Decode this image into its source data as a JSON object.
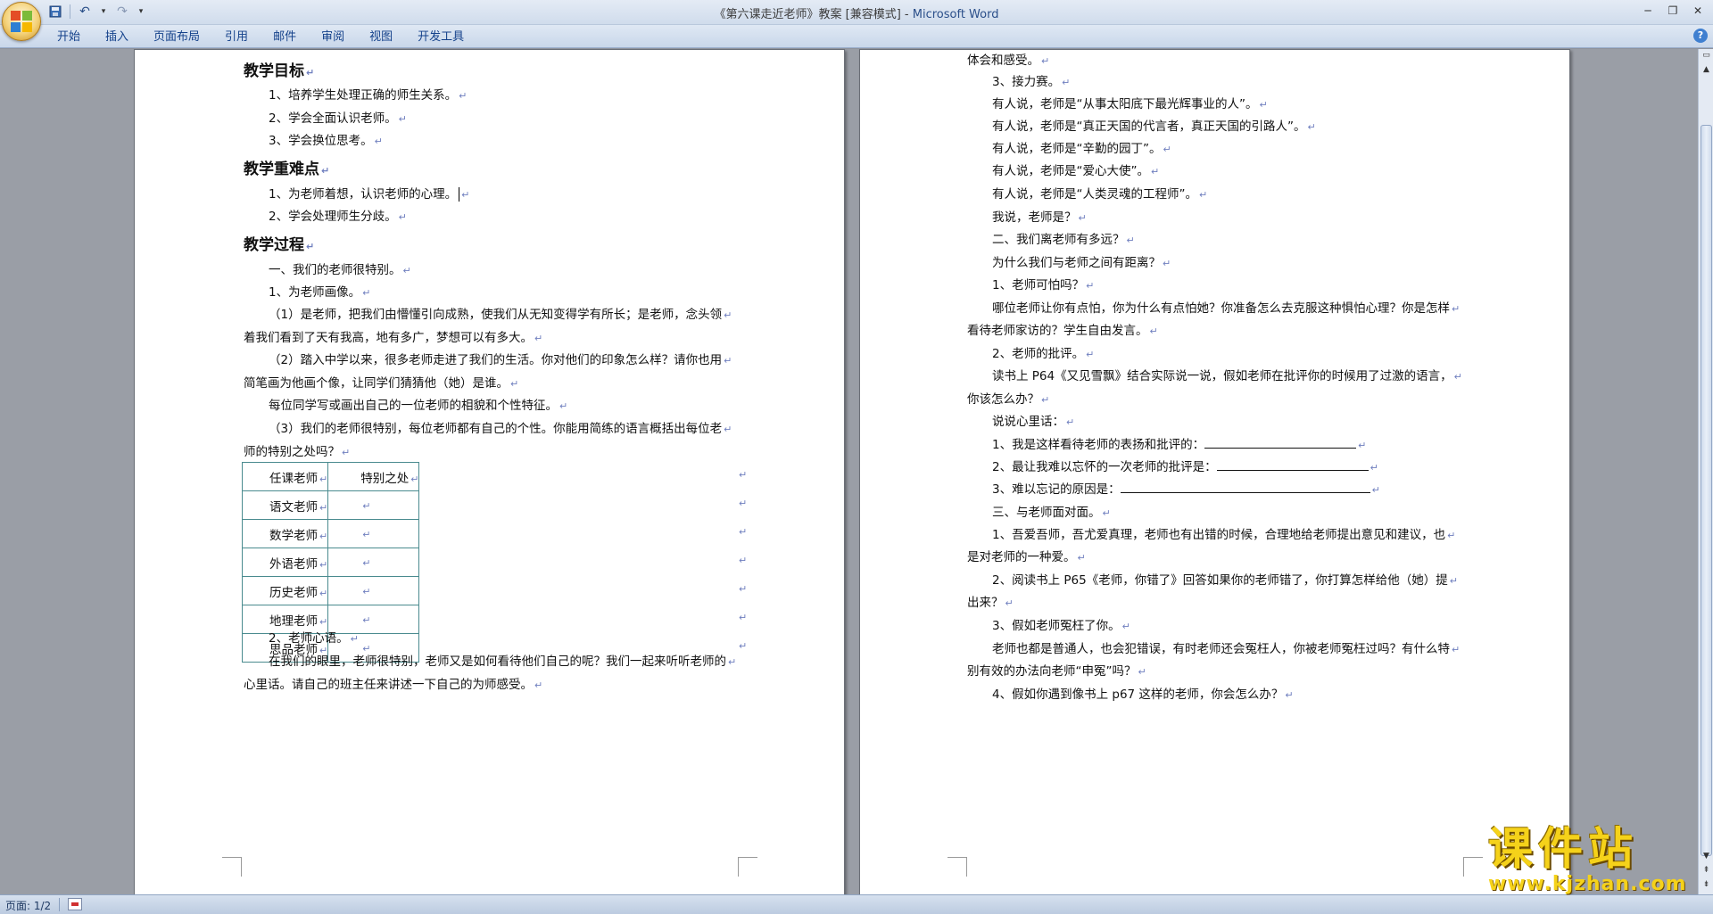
{
  "window": {
    "title_doc": "《第六课走近老师》教案 [兼容模式] - ",
    "title_app": "Microsoft Word"
  },
  "ribbon": {
    "tabs": [
      "开始",
      "插入",
      "页面布局",
      "引用",
      "邮件",
      "审阅",
      "视图",
      "开发工具"
    ]
  },
  "icons": {
    "office_button": "office-logo-icon",
    "save": "save-icon",
    "undo": "undo-icon",
    "redo": "redo-icon",
    "help": "help-icon"
  },
  "left_page": {
    "lines": [
      {
        "text": "教学目标",
        "type": "heading"
      },
      {
        "text": "1、培养学生处理正确的师生关系。",
        "type": "body"
      },
      {
        "text": "2、学会全面认识老师。",
        "type": "body"
      },
      {
        "text": "3、学会换位思考。",
        "type": "body"
      },
      {
        "text": "教学重难点",
        "type": "heading"
      },
      {
        "text": "1、为老师着想，认识老师的心理。",
        "type": "body"
      },
      {
        "text": "2、学会处理师生分歧。",
        "type": "body"
      },
      {
        "text": "教学过程",
        "type": "heading"
      },
      {
        "text": "一、我们的老师很特别。",
        "type": "body"
      },
      {
        "text": "1、为老师画像。",
        "type": "body"
      },
      {
        "text": "（1）是老师，把我们由懵懂引向成熟，使我们从无知变得学有所长；是老师，念头领",
        "type": "body"
      },
      {
        "text": "着我们看到了天有我高，地有多广，梦想可以有多大。",
        "type": "cont"
      },
      {
        "text": "（2）踏入中学以来，很多老师走进了我们的生活。你对他们的印象怎么样？请你也用",
        "type": "body"
      },
      {
        "text": "简笔画为他画个像，让同学们猜猜他（她）是谁。",
        "type": "cont"
      },
      {
        "text": "每位同学写或画出自己的一位老师的相貌和个性特征。",
        "type": "body"
      },
      {
        "text": "（3）我们的老师很特别，每位老师都有自己的个性。你能用简练的语言概括出每位老",
        "type": "body"
      },
      {
        "text": "师的特别之处吗？",
        "type": "cont"
      }
    ],
    "table": {
      "header": [
        "任课老师",
        "特别之处"
      ],
      "rows": [
        "语文老师",
        "数学老师",
        "外语老师",
        "历史老师",
        "地理老师",
        "思品老师"
      ]
    },
    "after_table": [
      {
        "text": "2、老师心语。",
        "type": "body"
      },
      {
        "text": "在我们的眼里，老师很特别，老师又是如何看待他们自己的呢？我们一起来听听老师的",
        "type": "body"
      },
      {
        "text": "心里话。请自己的班主任来讲述一下自己的为师感受。",
        "type": "cont"
      }
    ]
  },
  "right_page": {
    "lines": [
      {
        "text": "体会和感受。",
        "type": "cont"
      },
      {
        "text": "3、接力赛。",
        "type": "body"
      },
      {
        "text": "有人说，老师是“从事太阳底下最光辉事业的人”。",
        "type": "body"
      },
      {
        "text": "有人说，老师是“真正天国的代言者，真正天国的引路人”。",
        "type": "body"
      },
      {
        "text": "有人说，老师是“辛勤的园丁”。",
        "type": "body"
      },
      {
        "text": "有人说，老师是“爱心大使”。",
        "type": "body"
      },
      {
        "text": "有人说，老师是“人类灵魂的工程师”。",
        "type": "body"
      },
      {
        "text": "我说，老师是？",
        "type": "body"
      },
      {
        "text": "二、我们离老师有多远？",
        "type": "body"
      },
      {
        "text": "为什么我们与老师之间有距离？",
        "type": "body"
      },
      {
        "text": "1、老师可怕吗？",
        "type": "body"
      },
      {
        "text": "哪位老师让你有点怕，你为什么有点怕她？你准备怎么去克服这种惧怕心理？你是怎样",
        "type": "body"
      },
      {
        "text": "看待老师家访的？学生自由发言。",
        "type": "cont"
      },
      {
        "text": "2、老师的批评。",
        "type": "body"
      },
      {
        "text": "读书上 P64《又见雪飘》结合实际说一说，假如老师在批评你的时候用了过激的语言，",
        "type": "body"
      },
      {
        "text": "你该怎么办？",
        "type": "cont"
      },
      {
        "text": "说说心里话：",
        "type": "body"
      },
      {
        "text": "1、我是这样看待老师的表扬和批评的：",
        "type": "body"
      },
      {
        "text": "2、最让我难以忘怀的一次老师的批评是：",
        "type": "body"
      },
      {
        "text": "3、难以忘记的原因是：",
        "type": "body"
      },
      {
        "text": "三、与老师面对面。",
        "type": "body"
      },
      {
        "text": "1、吾爱吾师，吾尤爱真理，老师也有出错的时候，合理地给老师提出意见和建议，也",
        "type": "body"
      },
      {
        "text": "是对老师的一种爱。",
        "type": "cont"
      },
      {
        "text": "2、阅读书上 P65《老师，你错了》回答如果你的老师错了，你打算怎样给他（她）提",
        "type": "body"
      },
      {
        "text": "出来？",
        "type": "cont"
      },
      {
        "text": "3、假如老师冤枉了你。",
        "type": "body"
      },
      {
        "text": "老师也都是普通人，也会犯错误，有时老师还会冤枉人，你被老师冤枉过吗？有什么特",
        "type": "body"
      },
      {
        "text": "别有效的办法向老师“申冤”吗？",
        "type": "cont"
      },
      {
        "text": "4、假如你遇到像书上 p67 这样的老师，你会怎么办？",
        "type": "body"
      }
    ]
  },
  "statusbar": {
    "page": "页面: 1/2"
  },
  "watermark": {
    "title": "课件站",
    "url": "www.kjzhan.com"
  }
}
